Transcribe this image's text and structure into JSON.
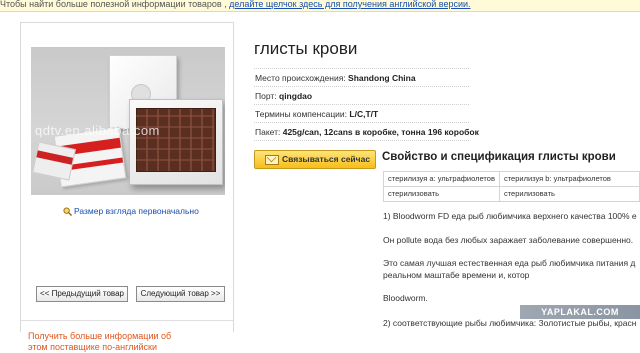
{
  "notice": {
    "text": "Чтобы найти больше полезной информации товаров , ",
    "link": "делайте щелчок здесь для получения английской версии."
  },
  "product": {
    "title": "глисты крови",
    "image_watermark": "qdtv.en.alibaba.com",
    "zoom_link": "Размер взгляда первоначально",
    "prev_button": "<< Предыдущий товар",
    "next_button": "Следующий товар >>",
    "more_info": "Получить больше информации об этом поставщике по-английски"
  },
  "attributes": [
    {
      "label": "Место происхождения: ",
      "value": "Shandong China"
    },
    {
      "label": "Порт: ",
      "value": "qingdao"
    },
    {
      "label": "Термины компенсации: ",
      "value": "L/C,T/T"
    },
    {
      "label": "Пакет: ",
      "value": "425g/can, 12cans в коробке, тонна 196 коробок"
    }
  ],
  "contact_button": "Связываться сейчас",
  "specs": {
    "title": "Свойство и спецификация глисты крови",
    "table": [
      [
        "стерилизуя a: ультрафиолетов",
        "стерилизуя b: ультрафиолетов"
      ],
      [
        "стерилизовать",
        "стерилизовать"
      ]
    ],
    "paragraphs": [
      "1) Bloodworm FD еда рыб любимчика верхнего качества 100% е",
      "Он pollute вода без любых заражает заболевание совершенно.",
      " Это самая лучшая естественная еда рыб любимчика питания д",
      "реальном маштабе времени и, котор",
      "Bloodworm.",
      "2) соответствующие рыбы любимчика: Золотистые рыбы, красн"
    ]
  },
  "site_watermark": "YAPLAKAL.COM",
  "colors": {
    "link": "#1a4fb0",
    "orange_text": "#e0561d",
    "button_yellow": "#f6bf18"
  }
}
